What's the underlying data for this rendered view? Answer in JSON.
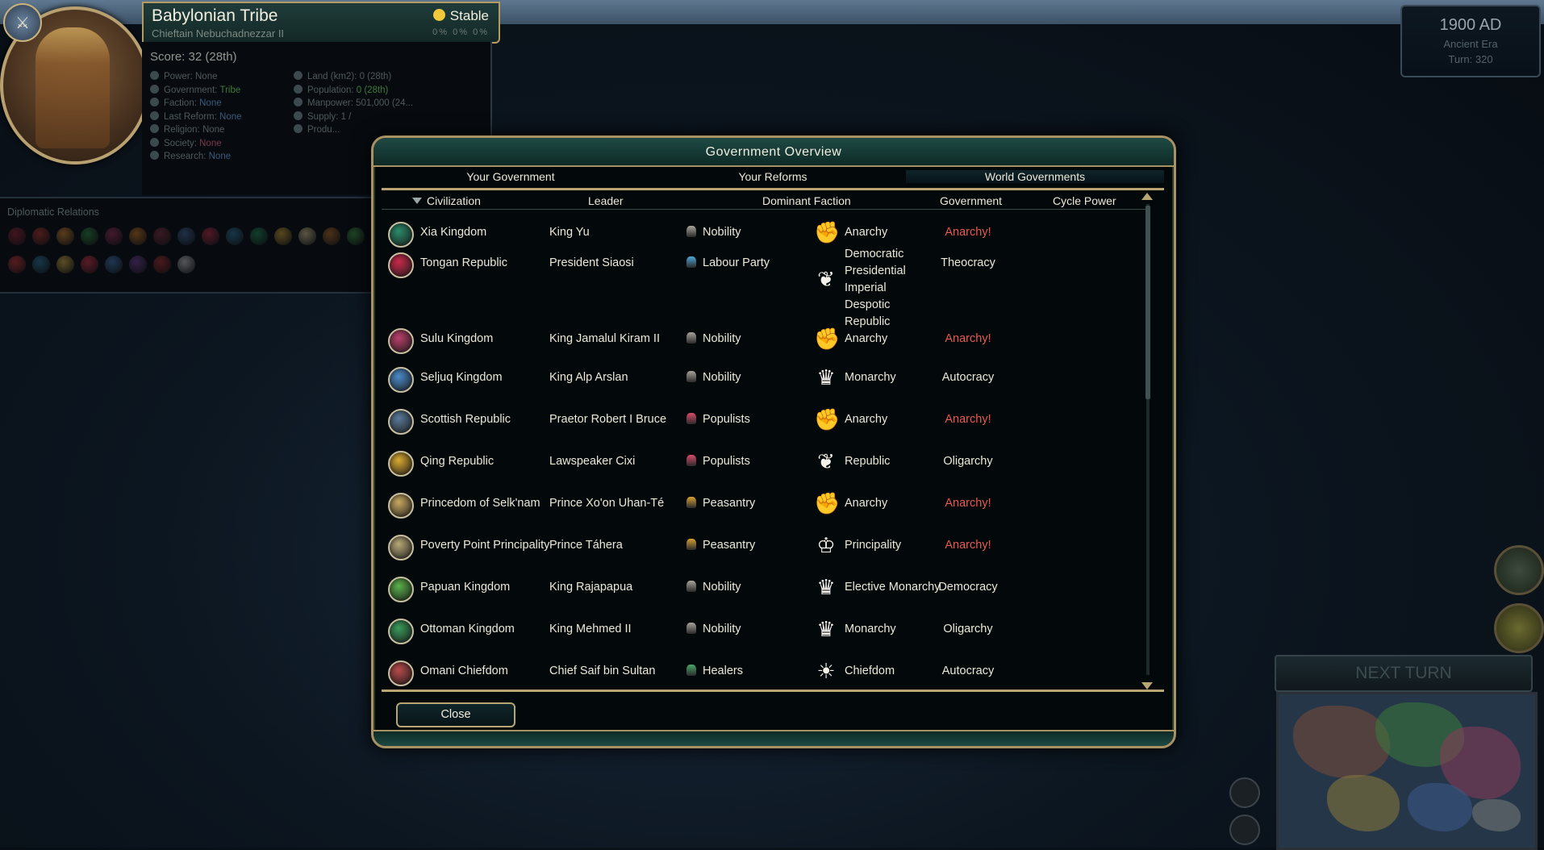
{
  "player": {
    "civ_name": "Babylonian Tribe",
    "leader": "Chieftain Nebuchadnezzar II",
    "stability": "Stable",
    "pcts": [
      "0%",
      "0%",
      "0%"
    ],
    "score": "Score: 32 (28th)",
    "stats_left": [
      {
        "label": "Power:",
        "value": "None",
        "style": "plain"
      },
      {
        "label": "Government:",
        "value": "Tribe",
        "style": "green"
      },
      {
        "label": "Faction:",
        "value": "None",
        "style": "blue"
      },
      {
        "label": "Last Reform:",
        "value": "None",
        "style": "blue"
      },
      {
        "label": "Religion:",
        "value": "None",
        "style": "plain"
      },
      {
        "label": "Society:",
        "value": "None",
        "style": "red"
      },
      {
        "label": "Research:",
        "value": "None",
        "style": "blue"
      }
    ],
    "stats_right": [
      {
        "label": "Land (km2):",
        "value": "0 (28th)",
        "style": "plain"
      },
      {
        "label": "Population:",
        "value": "0 (28th)",
        "style": "green"
      },
      {
        "label": "Manpower:",
        "value": "501,000 (24...",
        "style": "plain"
      },
      {
        "label": "Supply:",
        "value": "1 /",
        "style": "plain"
      },
      {
        "label": "Produ...",
        "value": "",
        "style": "plain"
      }
    ]
  },
  "diplomacy": {
    "title": "Diplomatic Relations",
    "chip_colors": [
      "#8a2030",
      "#a03028",
      "#c07828",
      "#2a7a3a",
      "#8a2a4a",
      "#b06a20",
      "#7a2a3a",
      "#3a5a8a",
      "#a82a40",
      "#2a6a8a",
      "#1e7a4a",
      "#b89030",
      "#c0b080",
      "#a06020",
      "#3a8a40",
      "#b83030",
      "#2a6a8a",
      "#c0a040",
      "#c03040",
      "#3a6aa0",
      "#6a3a8a",
      "#9a2a2a",
      "#b0b0b0"
    ]
  },
  "date": {
    "year": "1900 AD",
    "era": "Ancient Era",
    "turn": "Turn: 320"
  },
  "next_turn_label": "NEXT TURN",
  "dialog": {
    "title": "Government Overview",
    "tabs": [
      "Your Government",
      "Your Reforms",
      "World Governments"
    ],
    "active_tab": 2,
    "columns": {
      "civilization": "Civilization",
      "leader": "Leader",
      "faction": "Dominant Faction",
      "government": "Government",
      "cycle": "Cycle Power"
    },
    "rows": [
      {
        "civ": "Xia Kingdom",
        "leader": "King Yu",
        "faction": "Nobility",
        "faction_icon": "noble-icon",
        "gov": "Anarchy",
        "gov_icon": "fist-icon",
        "cycle": "Anarchy!",
        "civ_color": "#2a8a6a"
      },
      {
        "civ": "Tongan Republic",
        "leader": "President Siaosi",
        "faction": "Labour Party",
        "faction_icon": "labour-icon",
        "gov": "Democratic Presidential Imperial Despotic Republic",
        "gov_icon": "laurel-icon",
        "cycle": "Theocracy",
        "civ_color": "#c82a4a"
      },
      {
        "civ": "Sulu Kingdom",
        "leader": "King Jamalul Kiram II",
        "faction": "Nobility",
        "faction_icon": "noble-icon",
        "gov": "Anarchy",
        "gov_icon": "fist-icon",
        "cycle": "Anarchy!",
        "civ_color": "#b8406a"
      },
      {
        "civ": "Seljuq Kingdom",
        "leader": "King Alp Arslan",
        "faction": "Nobility",
        "faction_icon": "noble-icon",
        "gov": "Monarchy",
        "gov_icon": "crown-icon",
        "cycle": "Autocracy",
        "civ_color": "#4a8ac8"
      },
      {
        "civ": "Scottish Republic",
        "leader": "Praetor Robert I Bruce",
        "faction": "Populists",
        "faction_icon": "populist-icon",
        "gov": "Anarchy",
        "gov_icon": "fist-icon",
        "cycle": "Anarchy!",
        "civ_color": "#5a7a9a"
      },
      {
        "civ": "Qing Republic",
        "leader": "Lawspeaker Cixi",
        "faction": "Populists",
        "faction_icon": "populist-icon",
        "gov": "Republic",
        "gov_icon": "laurel-icon",
        "cycle": "Oligarchy",
        "civ_color": "#d8a830"
      },
      {
        "civ": "Princedom of Selk'nam",
        "leader": "Prince Xo'on Uhan-Té",
        "faction": "Peasantry",
        "faction_icon": "peasant-icon",
        "gov": "Anarchy",
        "gov_icon": "fist-icon",
        "cycle": "Anarchy!",
        "civ_color": "#c8a860"
      },
      {
        "civ": "Poverty Point Principality",
        "leader": "Prince Táhera",
        "faction": "Peasantry",
        "faction_icon": "peasant-icon",
        "gov": "Principality",
        "gov_icon": "coronet-icon",
        "cycle": "Anarchy!",
        "civ_color": "#b8a878"
      },
      {
        "civ": "Papuan Kingdom",
        "leader": "King Rajapapua",
        "faction": "Nobility",
        "faction_icon": "noble-icon",
        "gov": "Elective Monarchy",
        "gov_icon": "crown-icon",
        "cycle": "Democracy",
        "civ_color": "#5ab04a"
      },
      {
        "civ": "Ottoman Kingdom",
        "leader": "King Mehmed II",
        "faction": "Nobility",
        "faction_icon": "noble-icon",
        "gov": "Monarchy",
        "gov_icon": "crown-icon",
        "cycle": "Oligarchy",
        "civ_color": "#3a9a5a"
      },
      {
        "civ": "Omani Chiefdom",
        "leader": "Chief Saif bin Sultan",
        "faction": "Healers",
        "faction_icon": "healer-icon",
        "gov": "Chiefdom",
        "gov_icon": "sunburst-icon",
        "cycle": "Autocracy",
        "civ_color": "#b84a4a"
      }
    ],
    "close_label": "Close"
  },
  "colors": {
    "accent_gold": "#b8a672",
    "anarchy_red": "#e85a4e",
    "title_teal": "#1e4a44"
  }
}
